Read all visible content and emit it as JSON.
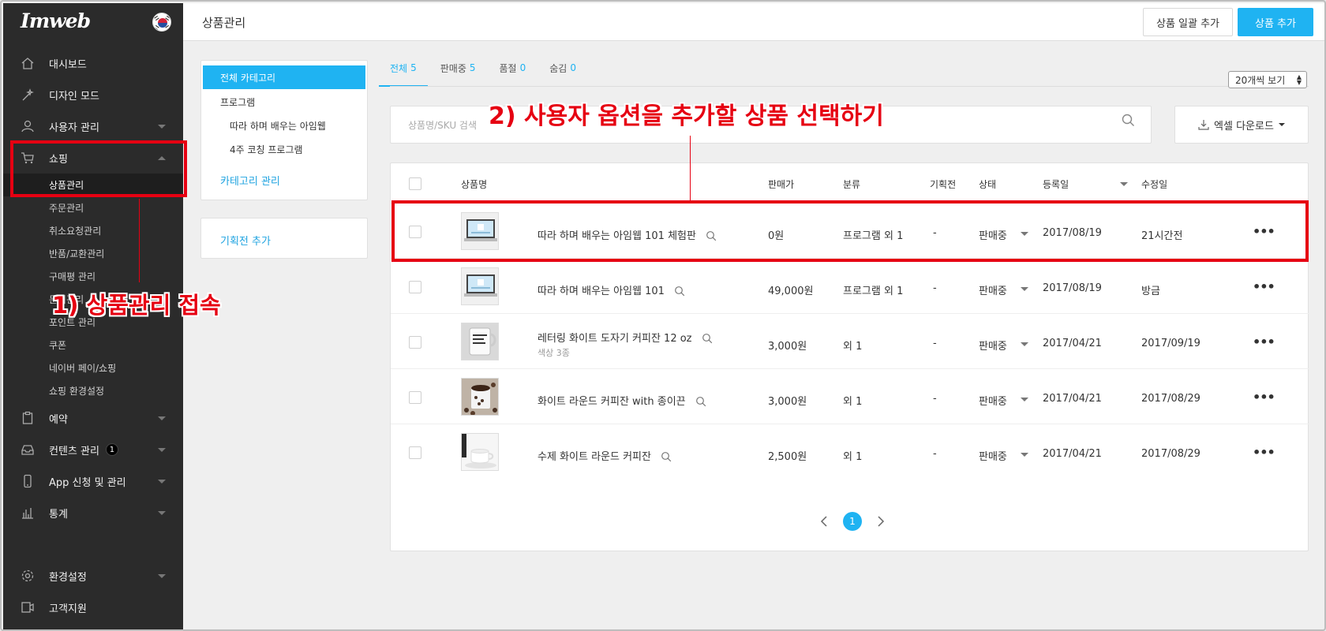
{
  "brand": {
    "logo": "Imweb",
    "accent": "#1fb3f2",
    "annotation_color": "#e60012"
  },
  "sidebar": {
    "items": [
      {
        "label": "대시보드",
        "icon": "home-icon"
      },
      {
        "label": "디자인 모드",
        "icon": "magic-wand-icon"
      },
      {
        "label": "사용자 관리",
        "icon": "user-icon"
      },
      {
        "label": "쇼핑",
        "icon": "cart-icon"
      }
    ],
    "shopping_sub": [
      "상품관리",
      "주문관리",
      "취소요청관리",
      "반품/교환관리",
      "구매평 관리",
      "문의관리",
      "포인트 관리",
      "쿠폰",
      "네이버 페이/쇼핑",
      "쇼핑 환경설정"
    ],
    "items2": [
      {
        "label": "예약",
        "icon": "clipboard-icon"
      },
      {
        "label": "컨텐츠 관리",
        "icon": "inbox-icon",
        "badge": "1"
      },
      {
        "label": "App 신청 및 관리",
        "icon": "mobile-icon"
      },
      {
        "label": "통계",
        "icon": "bar-chart-icon"
      }
    ],
    "bottom": [
      {
        "label": "환경설정",
        "icon": "gear-icon"
      },
      {
        "label": "고객지원",
        "icon": "support-icon"
      }
    ]
  },
  "header": {
    "title": "상품관리",
    "bulk_add": "상품 일괄 추가",
    "add": "상품 추가"
  },
  "categories": {
    "all": "전체 카테고리",
    "group": "프로그램",
    "children": [
      "따라 하며 배우는 아임웹",
      "4주 코칭 프로그램"
    ],
    "manage": "카테고리 관리",
    "exhibit_add": "기획전 추가"
  },
  "tabs": [
    {
      "label": "전체",
      "count": "5"
    },
    {
      "label": "판매중",
      "count": "5"
    },
    {
      "label": "품절",
      "count": "0"
    },
    {
      "label": "숨김",
      "count": "0"
    }
  ],
  "per_page": "20개씩 보기",
  "search": {
    "placeholder": "상품명/SKU 검색"
  },
  "excel": "엑셀 다운로드",
  "table": {
    "headers": {
      "name": "상품명",
      "price": "판매가",
      "category": "분류",
      "exhibit": "기획전",
      "status": "상태",
      "registered": "등록일",
      "modified": "수정일"
    },
    "rows": [
      {
        "name": "따라 하며 배우는 아임웹 101 체험판",
        "sub": "",
        "price": "0원",
        "category": "프로그램 외 1",
        "exhibit": "-",
        "status": "판매중",
        "registered": "2017/08/19",
        "modified": "21시간전",
        "thumb": "laptop"
      },
      {
        "name": "따라 하며 배우는 아임웹 101",
        "sub": "",
        "price": "49,000원",
        "category": "프로그램 외 1",
        "exhibit": "-",
        "status": "판매중",
        "registered": "2017/08/19",
        "modified": "방금",
        "thumb": "laptop"
      },
      {
        "name": "레터링 화이트 도자기 커피잔 12 oz",
        "sub": "색상 3종",
        "price": "3,000원",
        "category": "외 1",
        "exhibit": "-",
        "status": "판매중",
        "registered": "2017/04/21",
        "modified": "2017/09/19",
        "thumb": "mug-lettering"
      },
      {
        "name": "화이트 라운드 커피잔 with 종이끈",
        "sub": "",
        "price": "3,000원",
        "category": "외 1",
        "exhibit": "-",
        "status": "판매중",
        "registered": "2017/04/21",
        "modified": "2017/08/29",
        "thumb": "coffee-beans"
      },
      {
        "name": "수제 화이트 라운드 커피잔",
        "sub": "",
        "price": "2,500원",
        "category": "외 1",
        "exhibit": "-",
        "status": "판매중",
        "registered": "2017/04/21",
        "modified": "2017/08/29",
        "thumb": "white-cup"
      }
    ]
  },
  "pagination": {
    "current": "1"
  },
  "annotations": {
    "step1": "1) 상품관리 접속",
    "step2": "2) 사용자 옵션을 추가할 상품 선택하기"
  }
}
